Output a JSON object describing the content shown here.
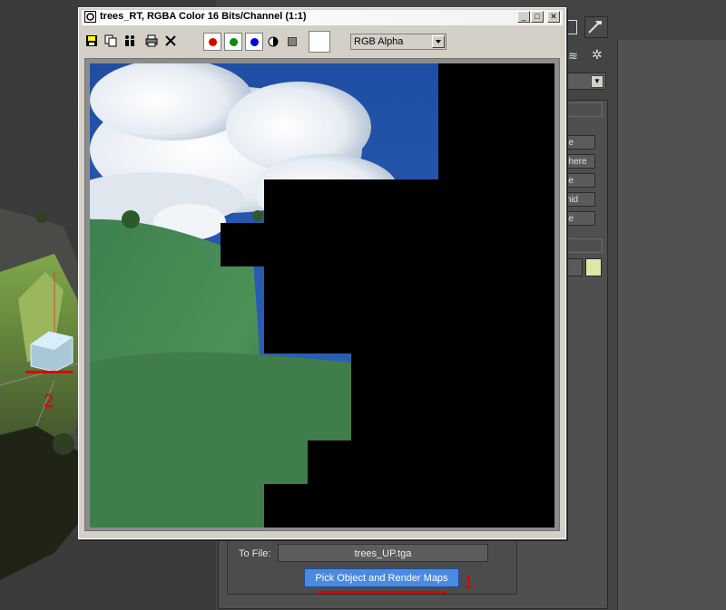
{
  "frame_window": {
    "title": "trees_RT, RGBA Color 16 Bits/Channel (1:1)",
    "channel_select": "RGB Alpha",
    "toolbar_icons": [
      "save-icon",
      "copy-icon",
      "clone-icon",
      "print-icon",
      "clear-icon"
    ],
    "channel_toggles": [
      {
        "name": "red-channel-toggle",
        "color": "#e00000"
      },
      {
        "name": "green-channel-toggle",
        "color": "#009000"
      },
      {
        "name": "blue-channel-toggle",
        "color": "#0000e0"
      }
    ]
  },
  "side_buttons": [
    "ne",
    "phere",
    "pe",
    "mid",
    "ne"
  ],
  "render_panel": {
    "to_file_label": "To File:",
    "to_file_value": "trees_UP.tga",
    "pick_button": "Pick Object and Render Maps"
  },
  "annotations": {
    "marker_1": "1",
    "marker_2": "2"
  }
}
